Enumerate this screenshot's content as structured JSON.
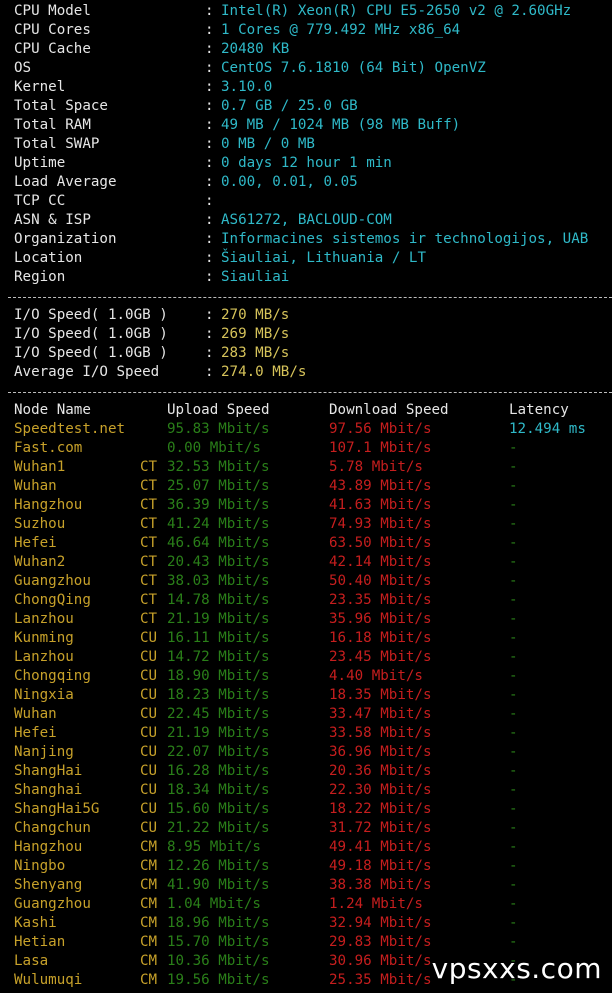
{
  "sysinfo": [
    {
      "label": "CPU Model",
      "value": "Intel(R) Xeon(R) CPU E5-2650 v2 @ 2.60GHz"
    },
    {
      "label": "CPU Cores",
      "value": "1 Cores @ 779.492 MHz x86_64"
    },
    {
      "label": "CPU Cache",
      "value": "20480 KB"
    },
    {
      "label": "OS",
      "value": "CentOS 7.6.1810 (64 Bit) OpenVZ"
    },
    {
      "label": "Kernel",
      "value": "3.10.0"
    },
    {
      "label": "Total Space",
      "value": "0.7 GB / 25.0 GB"
    },
    {
      "label": "Total RAM",
      "value": "49 MB / 1024 MB (98 MB Buff)"
    },
    {
      "label": "Total SWAP",
      "value": "0 MB / 0 MB"
    },
    {
      "label": "Uptime",
      "value": "0 days 12 hour 1 min"
    },
    {
      "label": "Load Average",
      "value": "0.00, 0.01, 0.05"
    },
    {
      "label": "TCP CC",
      "value": ""
    },
    {
      "label": "ASN & ISP",
      "value": "AS61272, BACLOUD-COM"
    },
    {
      "label": "Organization",
      "value": "Informacines sistemos ir technologijos, UAB"
    },
    {
      "label": "Location",
      "value": "Šiauliai, Lithuania / LT"
    },
    {
      "label": "Region",
      "value": "Siauliai"
    }
  ],
  "io": [
    {
      "label": "I/O Speed( 1.0GB )",
      "value": "270 MB/s"
    },
    {
      "label": "I/O Speed( 1.0GB )",
      "value": "269 MB/s"
    },
    {
      "label": "I/O Speed( 1.0GB )",
      "value": "283 MB/s"
    },
    {
      "label": "Average I/O Speed",
      "value": "274.0 MB/s"
    }
  ],
  "speedtest": {
    "headers": {
      "node": "Node Name",
      "upload": "Upload Speed",
      "download": "Download Speed",
      "latency": "Latency"
    },
    "rows": [
      {
        "node": "Speedtest.net",
        "isp": "",
        "upload": "95.83 Mbit/s",
        "download": "97.56 Mbit/s",
        "latency": "12.494 ms"
      },
      {
        "node": "Fast.com",
        "isp": "",
        "upload": "0.00 Mbit/s",
        "download": "107.1 Mbit/s",
        "latency": "-"
      },
      {
        "node": "Wuhan1",
        "isp": "CT",
        "upload": "32.53 Mbit/s",
        "download": "5.78 Mbit/s",
        "latency": "-"
      },
      {
        "node": "Wuhan",
        "isp": "CT",
        "upload": "25.07 Mbit/s",
        "download": "43.89 Mbit/s",
        "latency": "-"
      },
      {
        "node": "Hangzhou",
        "isp": "CT",
        "upload": "36.39 Mbit/s",
        "download": "41.63 Mbit/s",
        "latency": "-"
      },
      {
        "node": "Suzhou",
        "isp": "CT",
        "upload": "41.24 Mbit/s",
        "download": "74.93 Mbit/s",
        "latency": "-"
      },
      {
        "node": "Hefei",
        "isp": "CT",
        "upload": "46.64 Mbit/s",
        "download": "63.50 Mbit/s",
        "latency": "-"
      },
      {
        "node": "Wuhan2",
        "isp": "CT",
        "upload": "20.43 Mbit/s",
        "download": "42.14 Mbit/s",
        "latency": "-"
      },
      {
        "node": "Guangzhou",
        "isp": "CT",
        "upload": "38.03 Mbit/s",
        "download": "50.40 Mbit/s",
        "latency": "-"
      },
      {
        "node": "ChongQing",
        "isp": "CT",
        "upload": "14.78 Mbit/s",
        "download": "23.35 Mbit/s",
        "latency": "-"
      },
      {
        "node": "Lanzhou",
        "isp": "CT",
        "upload": "21.19 Mbit/s",
        "download": "35.96 Mbit/s",
        "latency": "-"
      },
      {
        "node": "Kunming",
        "isp": "CU",
        "upload": "16.11 Mbit/s",
        "download": "16.18 Mbit/s",
        "latency": "-"
      },
      {
        "node": "Lanzhou",
        "isp": "CU",
        "upload": "14.72 Mbit/s",
        "download": "23.45 Mbit/s",
        "latency": "-"
      },
      {
        "node": "Chongqing",
        "isp": "CU",
        "upload": "18.90 Mbit/s",
        "download": "4.40 Mbit/s",
        "latency": "-"
      },
      {
        "node": "Ningxia",
        "isp": "CU",
        "upload": "18.23 Mbit/s",
        "download": "18.35 Mbit/s",
        "latency": "-"
      },
      {
        "node": "Wuhan",
        "isp": "CU",
        "upload": "22.45 Mbit/s",
        "download": "33.47 Mbit/s",
        "latency": "-"
      },
      {
        "node": "Hefei",
        "isp": "CU",
        "upload": "21.19 Mbit/s",
        "download": "33.58 Mbit/s",
        "latency": "-"
      },
      {
        "node": "Nanjing",
        "isp": "CU",
        "upload": "22.07 Mbit/s",
        "download": "36.96 Mbit/s",
        "latency": "-"
      },
      {
        "node": "ShangHai",
        "isp": "CU",
        "upload": "16.28 Mbit/s",
        "download": "20.36 Mbit/s",
        "latency": "-"
      },
      {
        "node": "Shanghai",
        "isp": "CU",
        "upload": "18.34 Mbit/s",
        "download": "22.30 Mbit/s",
        "latency": "-"
      },
      {
        "node": "ShangHai5G",
        "isp": "CU",
        "upload": "15.60 Mbit/s",
        "download": "18.22 Mbit/s",
        "latency": "-"
      },
      {
        "node": "Changchun",
        "isp": "CU",
        "upload": "21.22 Mbit/s",
        "download": "31.72 Mbit/s",
        "latency": "-"
      },
      {
        "node": "Hangzhou",
        "isp": "CM",
        "upload": "8.95 Mbit/s",
        "download": "49.41 Mbit/s",
        "latency": "-"
      },
      {
        "node": "Ningbo",
        "isp": "CM",
        "upload": "12.26 Mbit/s",
        "download": "49.18 Mbit/s",
        "latency": "-"
      },
      {
        "node": "Shenyang",
        "isp": "CM",
        "upload": "41.90 Mbit/s",
        "download": "38.38 Mbit/s",
        "latency": "-"
      },
      {
        "node": "Guangzhou",
        "isp": "CM",
        "upload": "1.04 Mbit/s",
        "download": "1.24 Mbit/s",
        "latency": "-"
      },
      {
        "node": "Kashi",
        "isp": "CM",
        "upload": "18.96 Mbit/s",
        "download": "32.94 Mbit/s",
        "latency": "-"
      },
      {
        "node": "Hetian",
        "isp": "CM",
        "upload": "15.70 Mbit/s",
        "download": "29.83 Mbit/s",
        "latency": "-"
      },
      {
        "node": "Lasa",
        "isp": "CM",
        "upload": "10.36 Mbit/s",
        "download": "30.96 Mbit/s",
        "latency": "-"
      },
      {
        "node": "Wulumuqi",
        "isp": "CM",
        "upload": "19.56 Mbit/s",
        "download": "25.35 Mbit/s",
        "latency": "-"
      }
    ]
  },
  "separator": ":",
  "watermark": "vpsxxs.com",
  "colors": {
    "background": "#000000",
    "label": "#e6e6e6",
    "value": "#2fb9c8",
    "io_value": "#d6c35a",
    "node": "#c7a12a",
    "upload": "#2a7f19",
    "download": "#c61e1e"
  }
}
